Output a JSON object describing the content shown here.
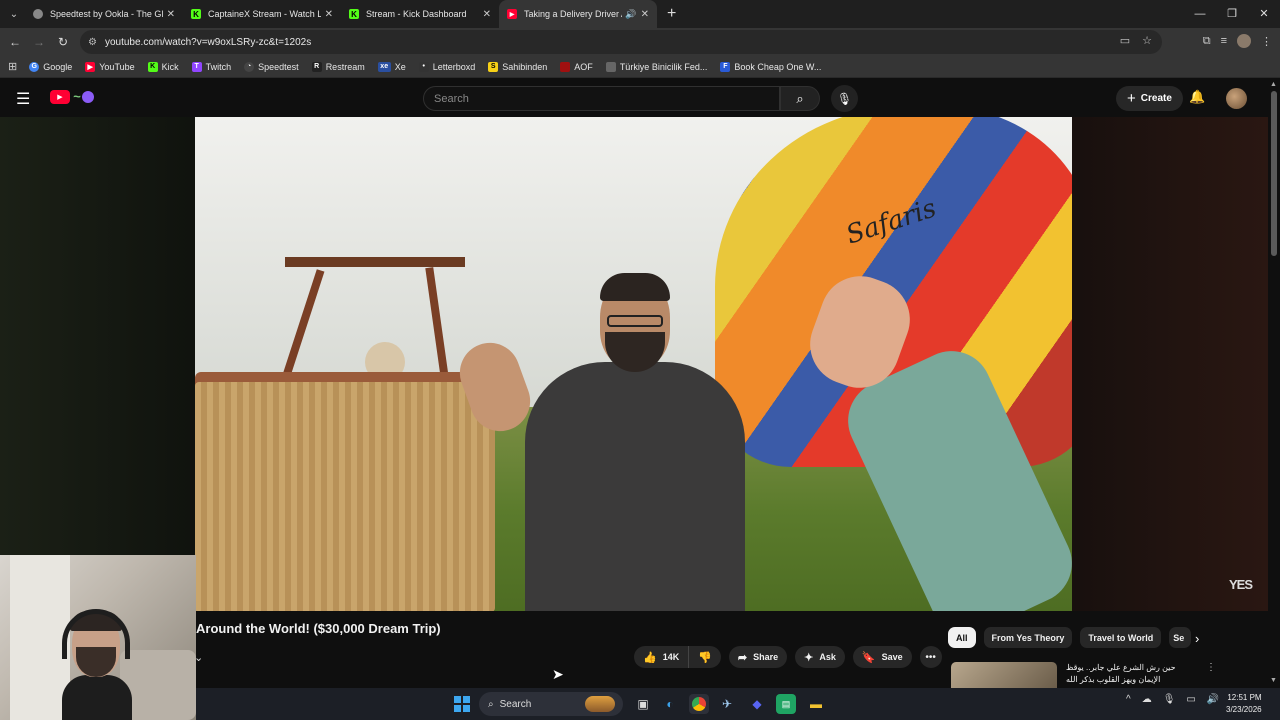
{
  "browser": {
    "tabs": [
      {
        "title": "Speedtest by Ookla - The Global",
        "favicon_color": "#888888",
        "active": false
      },
      {
        "title": "CaptaineX Stream - Watch Live",
        "favicon_color": "#53fc18",
        "active": false
      },
      {
        "title": "Stream - Kick Dashboard",
        "favicon_color": "#53fc18",
        "active": false
      },
      {
        "title": "Taking a Delivery Driver Aro",
        "favicon_color": "#ff0033",
        "active": true
      }
    ],
    "url": "youtube.com/watch?v=w9oxLSRy-zc&t=1202s",
    "bookmarks": [
      {
        "label": "Google",
        "color": "#4285f4",
        "glyph": "G"
      },
      {
        "label": "YouTube",
        "color": "#ff0033",
        "glyph": "▶"
      },
      {
        "label": "Kick",
        "color": "#53fc18",
        "glyph": "K"
      },
      {
        "label": "Twitch",
        "color": "#9146ff",
        "glyph": "T"
      },
      {
        "label": "Speedtest",
        "color": "#444444",
        "glyph": "◔"
      },
      {
        "label": "Restream",
        "color": "#222222",
        "glyph": "R"
      },
      {
        "label": "Xe",
        "color": "#2a4fa0",
        "glyph": "xe"
      },
      {
        "label": "Letterboxd",
        "color": "#333333",
        "glyph": "•"
      },
      {
        "label": "Sahibinden",
        "color": "#f7d117",
        "glyph": "S"
      },
      {
        "label": "AOF",
        "color": "#a01010",
        "glyph": "A"
      },
      {
        "label": "Türkiye Binicilik Fed...",
        "color": "#666666",
        "glyph": "T"
      },
      {
        "label": "Book Cheap One W...",
        "color": "#2a5bd7",
        "glyph": "F"
      }
    ]
  },
  "youtube": {
    "search_placeholder": "Search",
    "create_label": "Create",
    "video_title": "Around the World! ($30,000 Dream Trip)",
    "watermark": "YES",
    "balloon_text": "Safaris",
    "like_count": "14K",
    "share_label": "Share",
    "ask_label": "Ask",
    "save_label": "Save",
    "chips": [
      "All",
      "From Yes Theory",
      "Travel to World",
      "Se"
    ],
    "reco_title": "حين رش الشرع علي جابر.. يوقظ الإيمان ويهز القلوب بذكر الله"
  },
  "taskbar": {
    "search_label": "Search",
    "time": "12:51 PM",
    "date": "3/23/2026"
  }
}
